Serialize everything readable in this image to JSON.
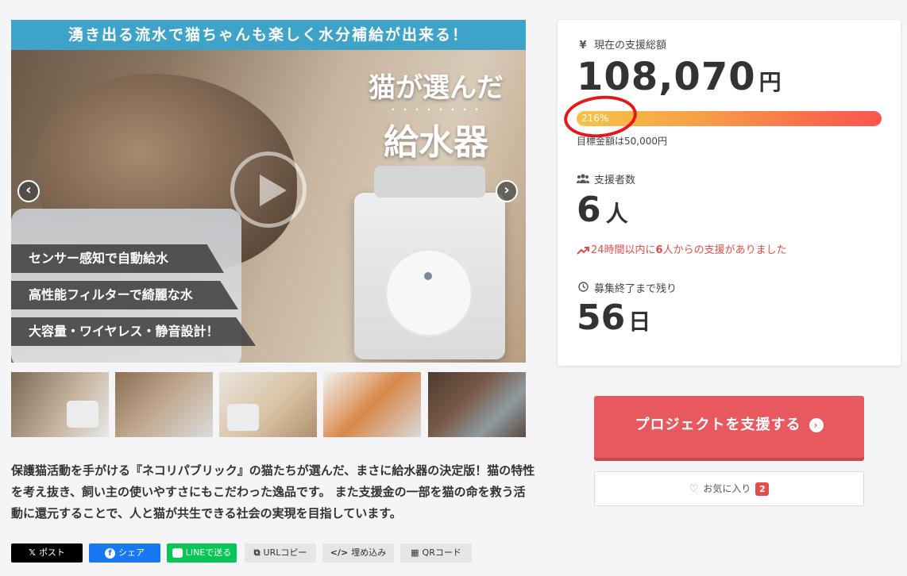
{
  "hero": {
    "banner": "湧き出る流水で猫ちゃんも楽しく水分補給が出来る！",
    "title_line1": "猫が選んだ",
    "dots": "・・・・・・・・",
    "title_line2": "給水器",
    "features": [
      "センサー感知で自動給水",
      "高性能フィルターで綺麗な水",
      "大容量・ワイヤレス・静音設計！"
    ],
    "prev_arrow": "‹",
    "next_arrow": "›"
  },
  "description": "保護猫活動を手がける『ネコリパブリック』の猫たちが選んだ、まさに給水器の決定版！猫の特性を考え抜き、飼い主の使いやすさにもこだわった逸品です。 また支援金の一部を猫の命を救う活動に還元することで、人と猫が共生できる社会の実現を目指しています。",
  "share": {
    "x_icon": "𝕏",
    "x_label": "ポスト",
    "fb_icon": "f",
    "fb_label": "シェア",
    "line_label": "LINEで送る",
    "url_icon": "⧉",
    "url_label": "URLコピー",
    "embed_icon": "</>",
    "embed_label": "埋め込み",
    "qr_icon": "▦",
    "qr_label": "QRコード"
  },
  "stats": {
    "total_icon": "¥",
    "total_label": "現在の支援総額",
    "total_amount": "108,070",
    "total_unit": "円",
    "progress_percent": 216,
    "progress_text": "216%",
    "goal_text": "目標金額は50,000円",
    "backers_label": "支援者数",
    "backers_count": "6",
    "backers_unit": "人",
    "trend_prefix": "24時間以内に",
    "trend_count": "6",
    "trend_suffix": "人からの支援がありました",
    "remain_label": "募集終了まで残り",
    "remain_days": "56",
    "remain_unit": "日"
  },
  "cta": {
    "label": "プロジェクトを支援する",
    "icon": "›"
  },
  "favorite": {
    "heart": "♡",
    "label": "お気に入り",
    "count": "2"
  },
  "colors": {
    "accent": "#e8585f",
    "banner": "#3ea3c8",
    "trend": "#e44b4b",
    "annotation_circle": "#e8151b"
  }
}
